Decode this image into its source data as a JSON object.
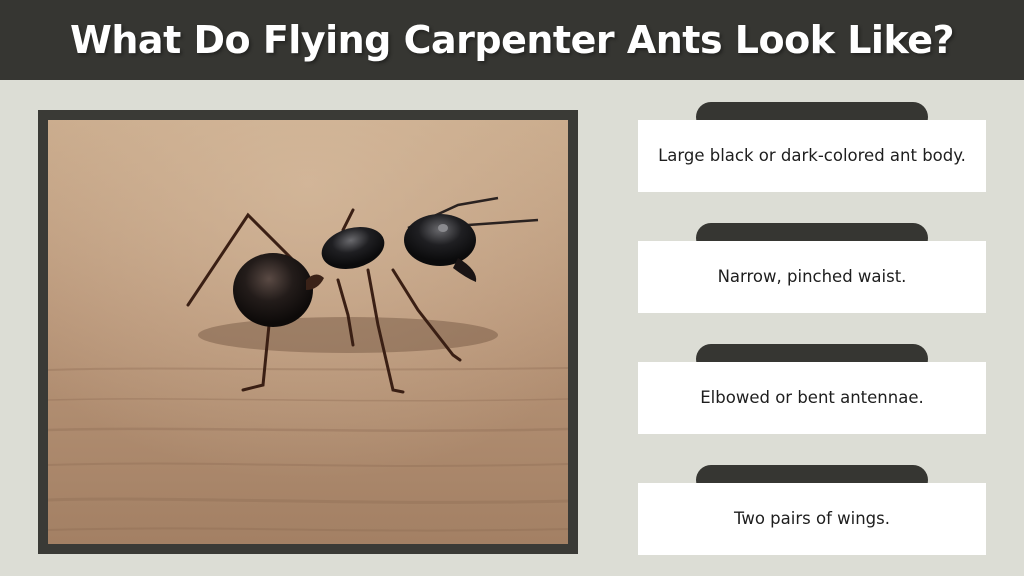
{
  "header": {
    "title": "What Do Flying Carpenter Ants Look Like?"
  },
  "colors": {
    "header_bg": "#363632",
    "page_bg": "#dcddd5",
    "pill": "#363632",
    "card_bg": "#ffffff"
  },
  "photo": {
    "subject": "ant-photo"
  },
  "features": [
    {
      "text": "Large black or dark-colored ant body."
    },
    {
      "text": "Narrow, pinched waist."
    },
    {
      "text": "Elbowed or bent antennae."
    },
    {
      "text": "Two pairs of wings."
    }
  ]
}
